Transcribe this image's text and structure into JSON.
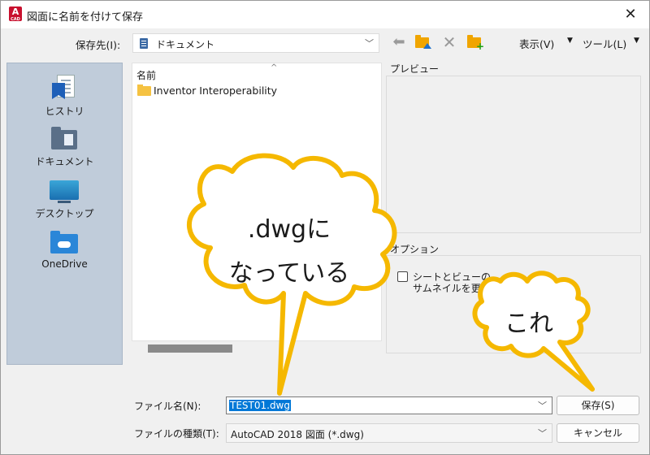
{
  "window": {
    "title": "図面に名前を付けて保存",
    "close": "✕",
    "app_icon_letter": "A",
    "app_icon_sub": "CAD"
  },
  "toolbar": {
    "save_in_label": "保存先(I):",
    "location": "ドキュメント",
    "view_menu": "表示(V)",
    "tools_menu": "ツール(L)"
  },
  "places": [
    {
      "label": "ヒストリ",
      "icon": "history-icon"
    },
    {
      "label": "ドキュメント",
      "icon": "documents-folder-icon"
    },
    {
      "label": "デスクトップ",
      "icon": "desktop-icon"
    },
    {
      "label": "OneDrive",
      "icon": "onedrive-folder-icon"
    }
  ],
  "file_list": {
    "column_name": "名前",
    "items": [
      {
        "name": "Inventor Interoperability",
        "type": "folder"
      }
    ]
  },
  "preview": {
    "label": "プレビュー"
  },
  "options": {
    "label": "オプション",
    "checkbox_line1": "シートとビューの",
    "checkbox_line2": "サムネイルを更新(U)",
    "checked": false
  },
  "form": {
    "filename_label": "ファイル名(N):",
    "filename_value": "TEST01.dwg",
    "filetype_label": "ファイルの種類(T):",
    "filetype_value": "AutoCAD 2018 図面 (*.dwg)",
    "save_button": "保存(S)",
    "cancel_button": "キャンセル"
  },
  "annotations": {
    "bubble1_line1": ".dwgに",
    "bubble1_line2": "なっている",
    "bubble2": "これ",
    "bubble_fill": "#ffffff",
    "bubble_stroke": "#f5b800"
  }
}
